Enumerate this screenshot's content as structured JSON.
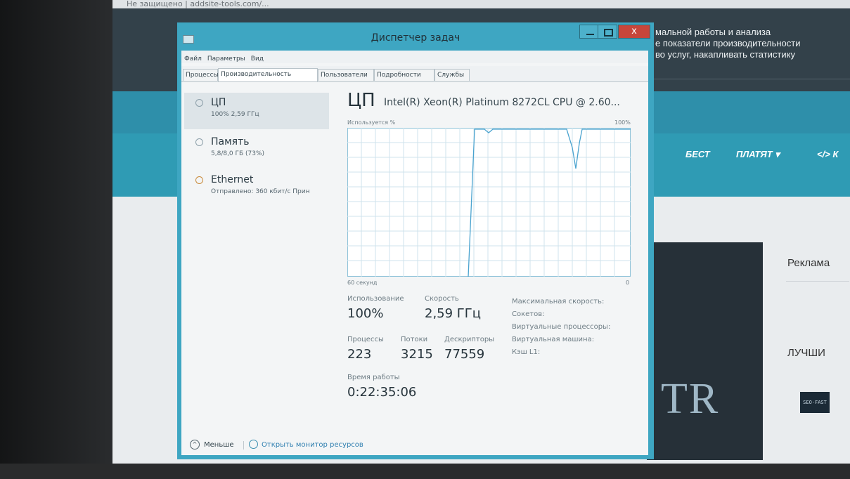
{
  "browser": {
    "address_text": "Не защищено | addsite-tools.com/..."
  },
  "website": {
    "header_lines": [
      "мальной работы и анализа",
      "е показатели производительности",
      "во услуг, накапливать статистику"
    ],
    "nav": {
      "item1": "БЕСТ",
      "item2": "ПЛАТЯТ ▾",
      "item3": "</> К"
    },
    "side_advert": "Реклама",
    "side_best": "ЛУЧШИ",
    "banner_logo": "TR",
    "thumb_text": "SEO-FAST"
  },
  "task_manager": {
    "title": "Диспетчер задач",
    "close_glyph": "x",
    "menu": [
      "Файл",
      "Параметры",
      "Вид"
    ],
    "tabs": [
      "Процессы",
      "Производительность",
      "Пользователи",
      "Подробности",
      "Службы"
    ],
    "sidebar": [
      {
        "name": "ЦП",
        "sub": "100% 2,59 ГГц"
      },
      {
        "name": "Память",
        "sub": "5,8/8,0 ГБ (73%)"
      },
      {
        "name": "Ethernet",
        "sub": "Отправлено: 360 кбит/с Прин"
      }
    ],
    "cpu": {
      "heading": "ЦП",
      "model": "Intel(R) Xeon(R) Platinum 8272CL CPU @ 2.60...",
      "usage_label": "Используется %",
      "max_label": "100%",
      "time_label": "60 секунд",
      "zero_label": "0",
      "stats": {
        "usage_label": "Использование",
        "usage_value": "100%",
        "speed_label": "Скорость",
        "speed_value": "2,59 ГГц",
        "processes_label": "Процессы",
        "processes_value": "223",
        "threads_label": "Потоки",
        "threads_value": "3215",
        "handles_label": "Дескрипторы",
        "handles_value": "77559",
        "uptime_label": "Время работы",
        "uptime_value": "0:22:35:06"
      },
      "right_labels": [
        "Максимальная скорость:",
        "Сокетов:",
        "Виртуальные процессоры:",
        "Виртуальная машина:",
        "Кэш L1:"
      ]
    },
    "footer": {
      "less": "Меньше",
      "monitor_link": "Открыть монитор ресурсов"
    }
  },
  "colors": {
    "window_frame": "#3ea6c2",
    "graph_line": "#4aa3cf",
    "graph_grid": "#cfe3ec"
  }
}
